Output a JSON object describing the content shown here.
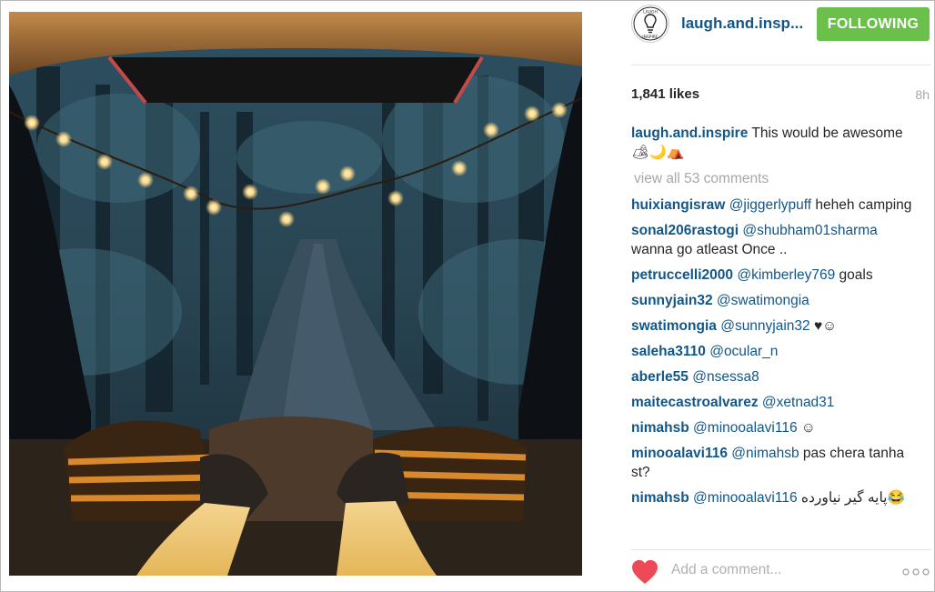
{
  "post": {
    "image_alt": "View from the open back of a car at night, string lights, forest road, legs in khaki pants on striped blanket"
  },
  "header": {
    "username": "laugh.and.insp...",
    "follow_label": "FOLLOWING",
    "avatar_icon": "laugh-and-inspire-logo",
    "follow_color": "#6bc04b"
  },
  "stats": {
    "likes": "1,841 likes",
    "time_ago": "8h"
  },
  "caption": {
    "user": "laugh.and.inspire",
    "text": " This would be awesome ",
    "emoji": "🏕🌙⛺"
  },
  "view_all": "view all 53 comments",
  "comments": [
    {
      "user": "huixiangisraw",
      "mention": "@jiggerlypuff",
      "text": " heheh camping"
    },
    {
      "user": "sonal206rastogi",
      "mention": "@shubham01sharma",
      "text": " wanna go atleast Once .."
    },
    {
      "user": "petruccelli2000",
      "mention": "@kimberley769",
      "text": " goals"
    },
    {
      "user": "sunnyjain32",
      "mention": "@swatimongia",
      "text": ""
    },
    {
      "user": "swatimongia",
      "mention": "@sunnyjain32",
      "text": " ♥☺"
    },
    {
      "user": "saleha3110",
      "mention": "@ocular_n",
      "text": ""
    },
    {
      "user": "aberle55",
      "mention": "@nsessa8",
      "text": ""
    },
    {
      "user": "maitecastroalvarez",
      "mention": "@xetnad31",
      "text": ""
    },
    {
      "user": "nimahsb",
      "mention": "@minooalavi116",
      "text": " ☺"
    },
    {
      "user": "minooalavi116",
      "mention": "@nimahsb",
      "text": " pas chera tanha st?"
    },
    {
      "user": "nimahsb",
      "mention": "@minooalavi116",
      "text": " پایه گیر نیاورده😂"
    }
  ],
  "footer": {
    "add_comment_placeholder": "Add a comment...",
    "like_icon": "heart-icon",
    "more_icon": "ellipsis-icon",
    "heart_color": "#ed4956"
  },
  "colors": {
    "username": "#125688",
    "muted": "#a5a7aa",
    "text": "#262626"
  }
}
